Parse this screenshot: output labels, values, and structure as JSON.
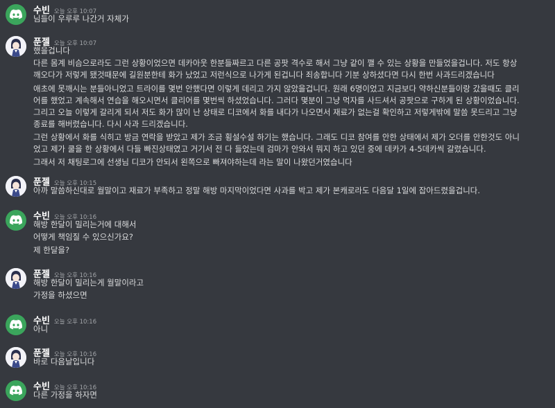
{
  "colors": {
    "background": "#36393f",
    "text": "#dcddde",
    "author": "#ffffff",
    "timestamp": "#a3a6aa",
    "discord_green": "#3ba55c"
  },
  "messages": [
    {
      "author": "수빈",
      "avatar": "discord-icon",
      "time": "오늘 오후 10:07",
      "lines": [
        "님들이 우루루 나간거 자체가"
      ]
    },
    {
      "author": "푼젤",
      "avatar": "anime-avatar",
      "time": "오늘 오후 10:07",
      "lines": [
        "했을겁니다",
        "다른 몸계 비슴으로라도 그런 상황이었으면 데카아웃 한분들짜르고 다른 공팟 격수로 해서 그냥 같이 깰 수 있는 상황을 만들었을겁니다. 저도 항상",
        "깨오다가 저렇게 됐것때문에 길원분한테 화가 났었고 저런식으로 나가게 된겁니다 죄송합니다 기분 상하셨다면 다시 한번 사과드리겠습니다",
        "애초에 못깨시는 분들아니었고 트라이를 몇번 안했다면 이렇게 데리고 가지 않았을겁니다. 원래 6명이었고 지금보다 약하신분들이랑 갔을때도 클리",
        "어를 했었고 계속해서 연습을 해오시면서 클리어를 몇번씩 하셨었습니다. 그러다 몇분이 그냥 먹자를 사드셔서 공팟으로 구하게 된 상황이었습니다.",
        "그리고 오늘 이렇게 갈리게 되서 저도 화가 많이 난 상태로 디코에서 화를 내다가 나오면서 재료가 없는걸 확인하고 저렇게밖에 말씀 못드리고 그냥",
        "종료를 해버렸습니다. 다시 사과 드리겠습니다.",
        "그런 상황에서 화를 식히고 방금 연락을 받았고 제가 조금 횡설수설 하기는 했습니다. 그래도 디코 참여를 안한 상태에서 제가 오더를 안한것도 아니",
        "었고 제가 쿨을 한 상황에서 다들 빠진상태였고 거기서 전 다 들었는데 검마가 안와서 뭐지 하고 있던 중에 데카가 4-5데카씩 갈렸습니다.",
        "그래서 저 채팅로그에 선생님 디코가 안되서 왼쪽으로 빠져야하는데  라는 말이 나왔던거였습니다"
      ]
    },
    {
      "author": "푼젤",
      "avatar": "anime-avatar",
      "time": "오늘 오후 10:15",
      "lines": [
        "아까 말씀하신대로 월말이고 재료가 부족하고 정말 해방 마지막이었다면 사과를 박고 제가 본캐로라도 다음달 1일에 잡아드렸을겁니다."
      ]
    },
    {
      "author": "수빈",
      "avatar": "discord-icon",
      "time": "오늘 오후 10:16",
      "lines": [
        "해방 한달이 밀리는거에 대해서",
        "어떻게 책임질 수 있으신가요?",
        "제 한달을?"
      ]
    },
    {
      "author": "푼젤",
      "avatar": "anime-avatar",
      "time": "오늘 오후 10:16",
      "lines": [
        "해방 한달이 밀리는게 월말이라고",
        "가정을 하셨으면"
      ]
    },
    {
      "author": "수빈",
      "avatar": "discord-icon",
      "time": "오늘 오후 10:16",
      "lines": [
        "아니"
      ]
    },
    {
      "author": "푼젤",
      "avatar": "anime-avatar",
      "time": "오늘 오후 10:16",
      "lines": [
        "바로 다음날입니다"
      ]
    },
    {
      "author": "수빈",
      "avatar": "discord-icon",
      "time": "오늘 오후 10:16",
      "lines": [
        "다른 가정을 하자면"
      ]
    }
  ]
}
